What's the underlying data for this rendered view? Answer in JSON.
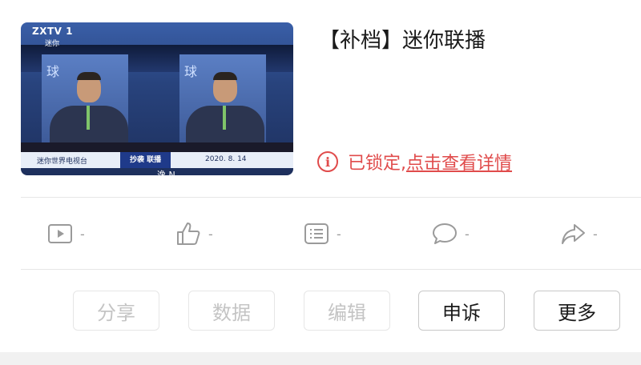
{
  "video": {
    "thumb_logo": "ZXTV 1",
    "thumb_logo_sub": "迷你",
    "thumb_panel_glyph": "球",
    "ticker_left": "迷你世界电视台",
    "ticker_mid": "抄袭 联播",
    "ticker_right": "2020. 8. 14",
    "thumb_caption": "逸 N",
    "title": "【补档】迷你联播",
    "lock_text_plain": "已锁定,",
    "lock_text_link": "点击查看详情"
  },
  "stats": [
    {
      "icon": "play-icon",
      "value": "-"
    },
    {
      "icon": "thumbs-up-icon",
      "value": "-"
    },
    {
      "icon": "list-icon",
      "value": "-"
    },
    {
      "icon": "comment-icon",
      "value": "-"
    },
    {
      "icon": "share-arrow-icon",
      "value": "-"
    }
  ],
  "actions": {
    "share": "分享",
    "data": "数据",
    "edit": "编辑",
    "appeal": "申诉",
    "more": "更多"
  },
  "colors": {
    "lock_red": "#e04b4b",
    "stat_gray": "#9a9a9a"
  }
}
